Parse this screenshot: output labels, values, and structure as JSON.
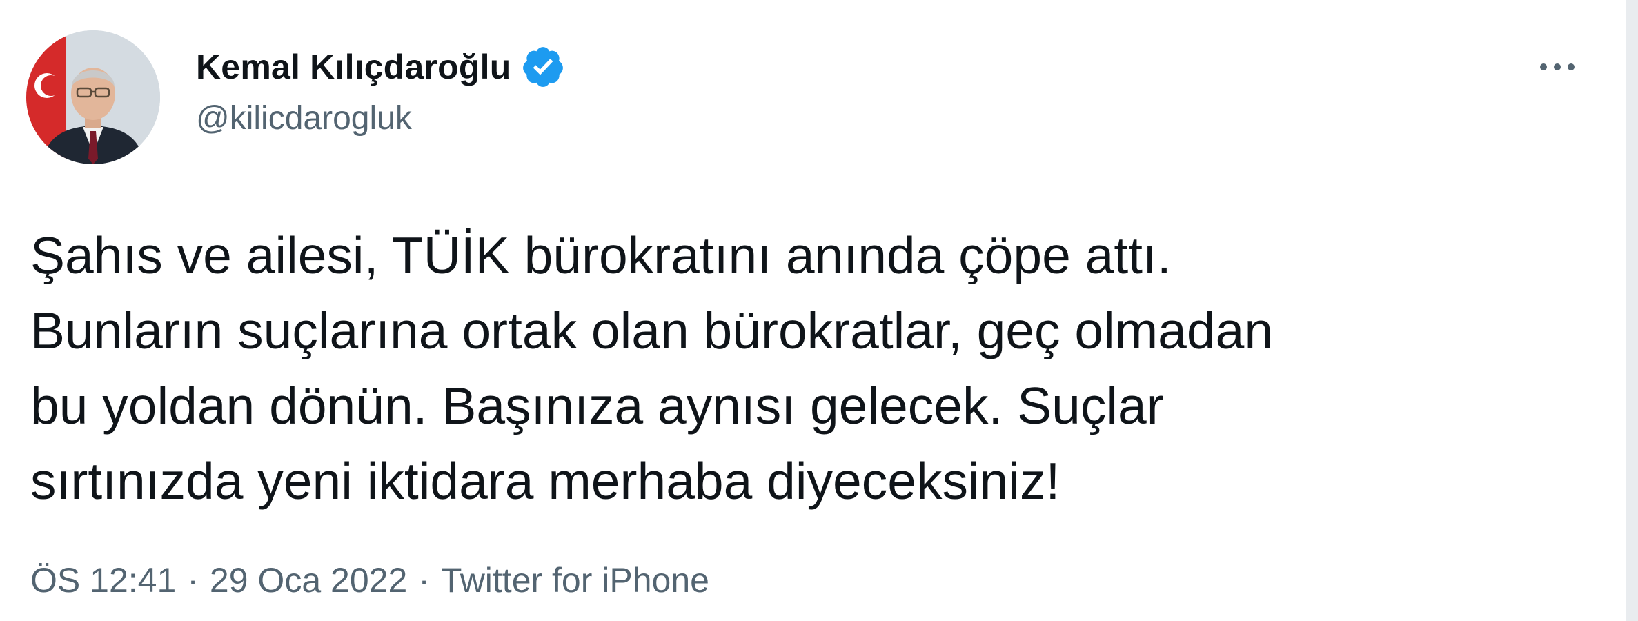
{
  "author": {
    "display_name": "Kemal Kılıçdaroğlu",
    "handle": "@kilicdarogluk",
    "verified": true,
    "verified_color": "#1d9bf0"
  },
  "tweet": {
    "text": "Şahıs ve ailesi, TÜİK bürokratını anında çöpe attı.\nBunların suçlarına ortak olan bürokratlar, geç olmadan\nbu yoldan dönün. Başınıza aynısı gelecek. Suçlar\nsırtınızda yeni iktidara merhaba diyeceksiniz!",
    "time": "ÖS 12:41",
    "separator": "·",
    "date": "29 Oca 2022",
    "source": "Twitter for iPhone"
  },
  "icons": {
    "more": "more-horizontal-icon",
    "verified": "verified-badge-icon"
  },
  "colors": {
    "text_primary": "#0f1419",
    "text_secondary": "#536471",
    "accent": "#1d9bf0"
  }
}
